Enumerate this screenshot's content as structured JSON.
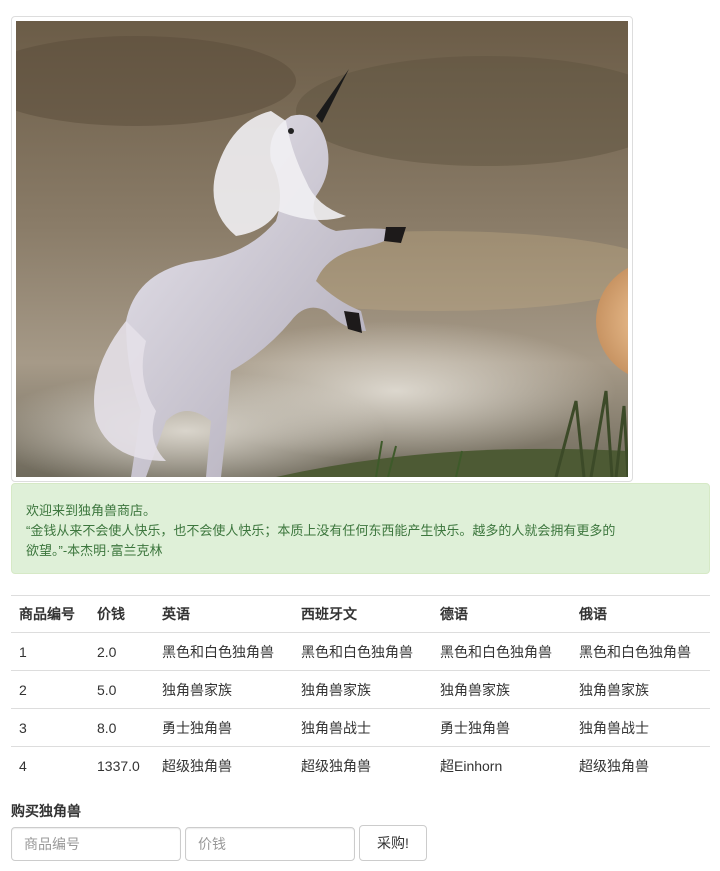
{
  "hero_image": {
    "icon": "unicorn-image"
  },
  "alert": {
    "line1": "欢迎来到独角兽商店。",
    "line2": "“金钱从来不会使人快乐，也不会使人快乐；本质上没有任何东西能产生快乐。越多的人就会拥有更多的",
    "line3": "欲望。”-本杰明·富兰克林"
  },
  "table": {
    "headers": [
      "商品编号",
      "价钱",
      "英语",
      "西班牙文",
      "德语",
      "俄语"
    ],
    "rows": [
      [
        "1",
        "2.0",
        "黑色和白色独角兽",
        "黑色和白色独角兽",
        "黑色和白色独角兽",
        "黑色和白色独角兽"
      ],
      [
        "2",
        "5.0",
        "独角兽家族",
        "独角兽家族",
        "独角兽家族",
        "独角兽家族"
      ],
      [
        "3",
        "8.0",
        "勇士独角兽",
        "独角兽战士",
        "勇士独角兽",
        "独角兽战士"
      ],
      [
        "4",
        "1337.0",
        "超级独角兽",
        "超级独角兽",
        "超Einhorn",
        "超级独角兽"
      ]
    ]
  },
  "purchase_form": {
    "label": "购买独角兽",
    "id_placeholder": "商品编号",
    "price_placeholder": "价钱",
    "submit_label": "采购!"
  },
  "colors": {
    "alert_bg": "#dff0d8",
    "alert_text": "#3c763d",
    "border": "#dddddd"
  }
}
